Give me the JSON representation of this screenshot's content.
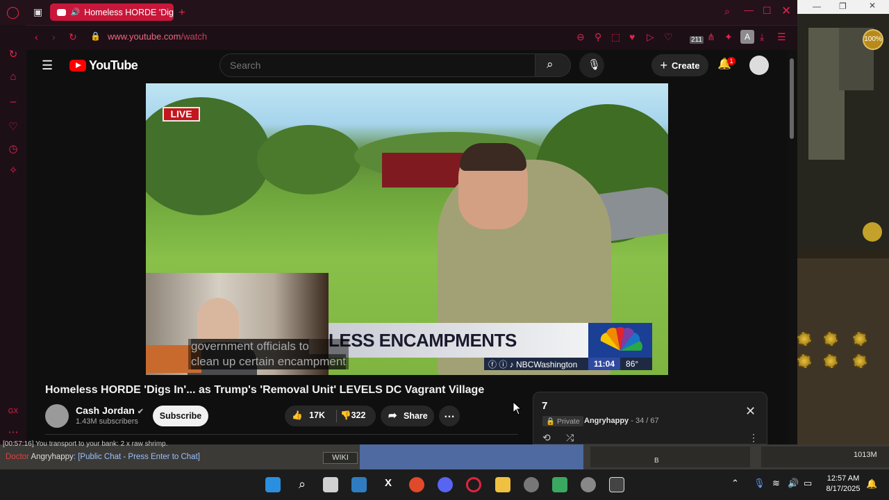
{
  "browser": {
    "tab_title": "Homeless HORDE 'Dig",
    "url_host": "www.youtube.com",
    "url_path": "/watch",
    "profile_initial": "A",
    "badge_211": "211"
  },
  "youtube": {
    "brand": "YouTube",
    "search_placeholder": "Search",
    "create_label": "Create",
    "notifications": "1",
    "video": {
      "live_badge": "LIVE",
      "lower_third": "LESS ENCAMPMENTS",
      "ticker_social": "NBCWashington",
      "ticker_time": "11:04",
      "ticker_temp": "86°",
      "caption_line1": "government officials to",
      "caption_line2": "clean up certain encampment"
    },
    "title": "Homeless HORDE 'Digs In'... as Trump's 'Removal Unit' LEVELS DC Vagrant Village",
    "channel": "Cash Jordan",
    "subscribers": "1.43M subscribers",
    "subscribe_label": "Subscribe",
    "likes": "17K",
    "dislikes": "322",
    "share_label": "Share",
    "playlist": {
      "number": "7",
      "privacy": "Private",
      "owner": "Angryhappy",
      "position": "- 34 / 67"
    }
  },
  "game": {
    "chat_line": "[00:57:16] You transport to your bank: 2 x raw shrimp.",
    "chat_prefix": "Doctor",
    "chat_name": "Angryhappy",
    "chat_prompt": ": [Public Chat - Press Enter to Chat]",
    "wiki_label": "WIKI",
    "gold": "1013M",
    "zoom": "100%",
    "skill_letter": "B"
  },
  "taskbar": {
    "time": "12:57 AM",
    "date": "8/17/2025"
  }
}
